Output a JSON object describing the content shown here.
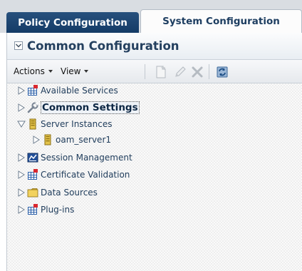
{
  "tabs": [
    {
      "label": "Policy Configuration",
      "active": false
    },
    {
      "label": "System Configuration",
      "active": true
    }
  ],
  "panel": {
    "title": "Common Configuration",
    "collapse_icon": "chevron-down-icon"
  },
  "toolbar": {
    "actions_label": "Actions",
    "view_label": "View",
    "icons": [
      "new-icon",
      "edit-icon",
      "delete-icon",
      "refresh-icon"
    ]
  },
  "tree": {
    "available_services": "Available Services",
    "common_settings": "Common Settings",
    "server_instances": "Server Instances",
    "oam_server1": "oam_server1",
    "session_management": "Session Management",
    "certificate_validation": "Certificate Validation",
    "data_sources": "Data Sources",
    "plug_ins": "Plug-ins"
  },
  "colors": {
    "tab_inactive_bg": "#1b426d",
    "title_text": "#24405f",
    "tree_text": "#1f3c5b"
  }
}
